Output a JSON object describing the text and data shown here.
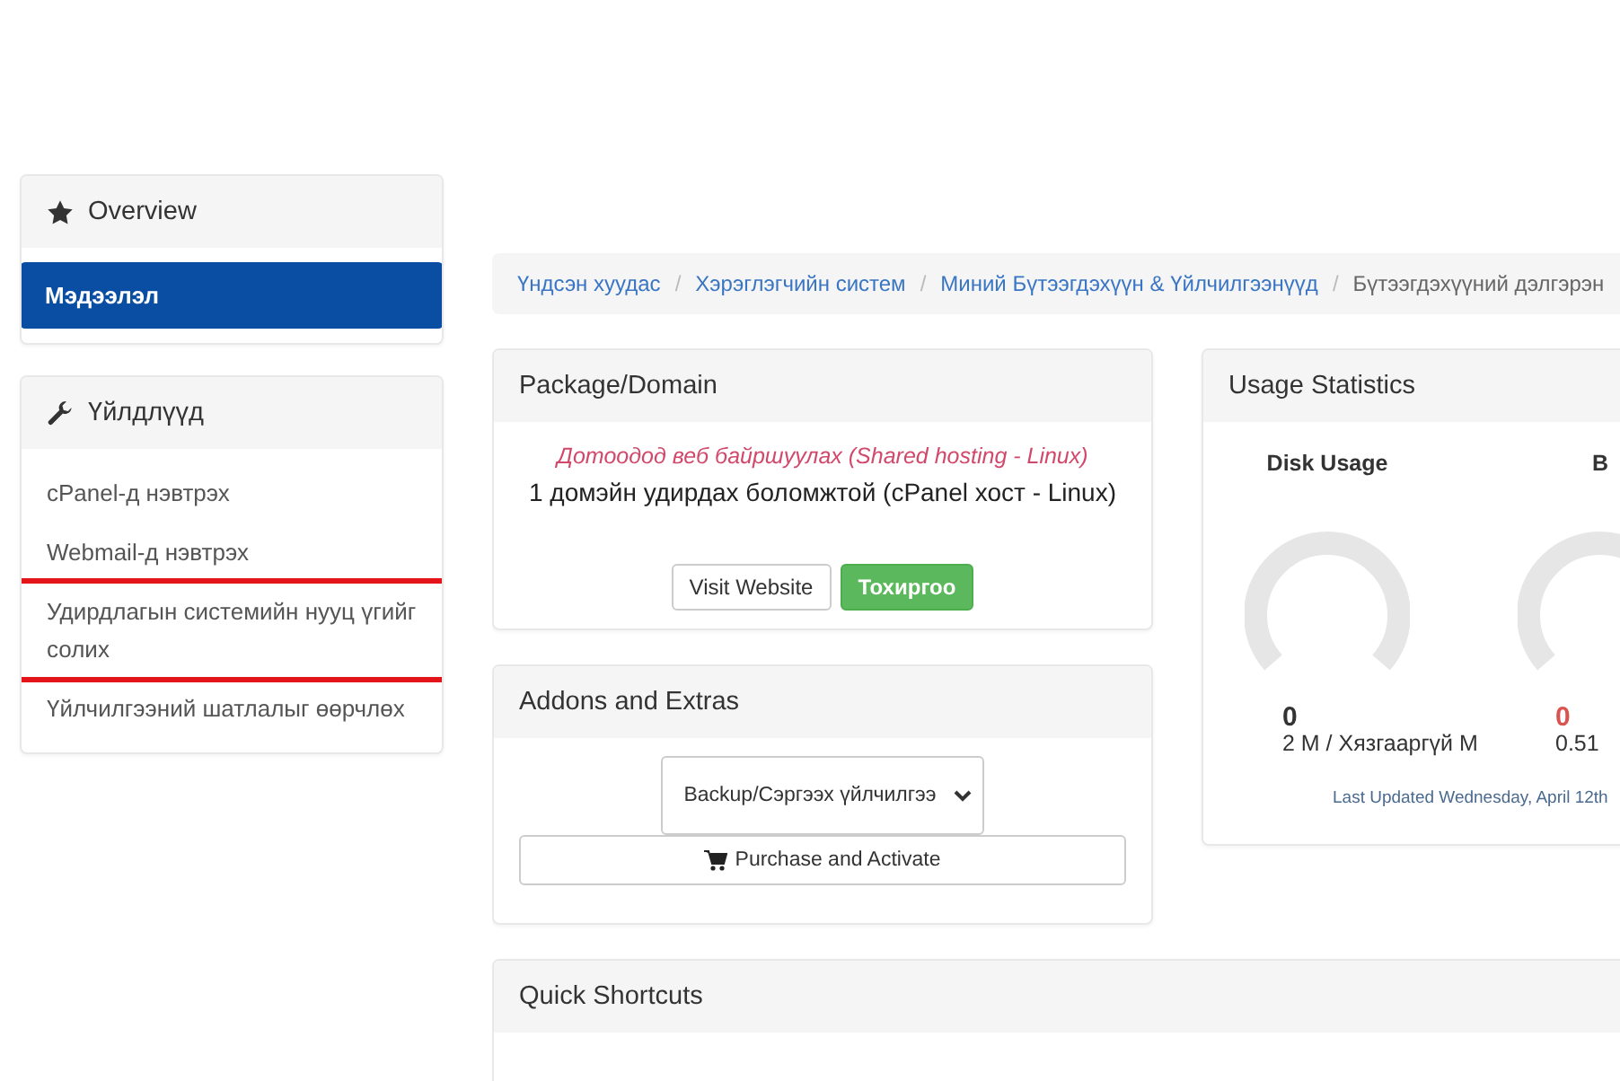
{
  "sidebar": [
    {
      "title": "Overview",
      "items": [
        {
          "label": "Мэдээлэл",
          "selected": true,
          "highlighted": false
        }
      ]
    },
    {
      "title": "Үйлдлүүд",
      "items": [
        {
          "label": "cPanel-д нэвтрэх",
          "selected": false,
          "highlighted": false
        },
        {
          "label": "Webmail-д нэвтрэх",
          "selected": false,
          "highlighted": false
        },
        {
          "label": "Удирдлагын системийн нууц үгийг солих",
          "selected": false,
          "highlighted": true
        },
        {
          "label": "Үйлчилгээний шатлалыг өөрчлөх",
          "selected": false,
          "highlighted": false
        }
      ]
    }
  ],
  "breadcrumb": [
    {
      "label": "Үндсэн хуудас",
      "kind": "link"
    },
    {
      "separator": "/",
      "label": "Хэрэглэгчийн систем",
      "kind": "link"
    },
    {
      "separator": "/",
      "label": "Миний Бүтээгдэхүүн & Үйлчилгээнүүд",
      "kind": "link"
    },
    {
      "separator": "/",
      "label": "Бүтээгдэхүүний дэлгэрэн",
      "kind": "current"
    }
  ],
  "package": {
    "title": "Package/Domain",
    "group": "Дотоодод веб байршуулах (Shared hosting - Linux)",
    "product": "1 домэйн удирдах боломжтой (cPanel хост - Linux)",
    "buttons": [
      {
        "label": "Visit Website",
        "kind": "default"
      },
      {
        "label": "Тохиргоо",
        "kind": "success"
      }
    ]
  },
  "addons": {
    "title": "Addons and Extras",
    "select": {
      "value": "Backup/Сэргээх үйлчилгээ"
    },
    "button": "Purchase and Activate"
  },
  "usage": {
    "title": "Usage Statistics",
    "gauges": [
      {
        "label": "Disk Usage",
        "value": "0",
        "detail": "2 M / Хязгааргүй M",
        "kind": "normal"
      },
      {
        "label": "B",
        "value": "0",
        "detail": "0.51",
        "kind": "alert"
      }
    ],
    "updated": "Last Updated Wednesday, April 12th"
  },
  "shortcuts": {
    "title": "Quick Shortcuts"
  }
}
